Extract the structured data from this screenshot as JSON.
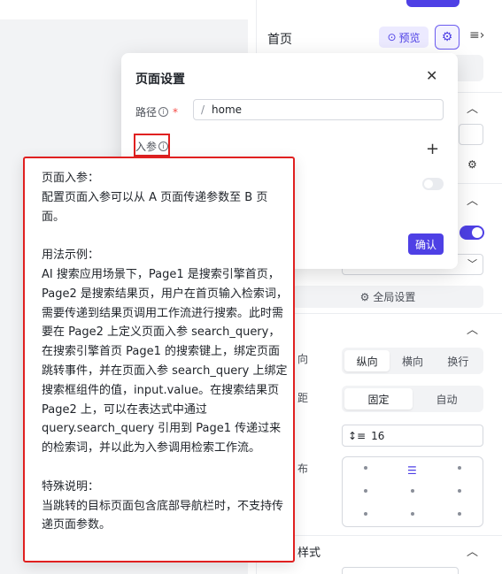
{
  "right_panel": {
    "title": "首页",
    "preview_label": "预览",
    "global_settings_label": "全局设置",
    "direction_options": [
      "纵向",
      "横向",
      "换行"
    ],
    "direction_selected": "纵向",
    "size_options": [
      "固定",
      "自动"
    ],
    "size_selected": "固定",
    "spacing_value": "16",
    "partial_labels": {
      "direction": "向",
      "spacing": "距",
      "align": "布",
      "style": "样式"
    }
  },
  "dialog": {
    "title": "页面设置",
    "path_label": "路径",
    "path_required": "*",
    "path_prefix": "/",
    "path_value": "home",
    "params_label": "入参",
    "confirm_label": "确认"
  },
  "tooltip": {
    "heading": "页面入参：",
    "intro": "配置页面入参可以从 A 页面传递参数至 B 页面。",
    "usage_heading": "用法示例：",
    "usage_body": "AI 搜索应用场景下，Page1 是搜索引擎首页，Page2 是搜索结果页，用户在首页输入检索词，需要传递到结果页调用工作流进行搜索。此时需要在 Page2 上定义页面入参 search_query，在搜索引擎首页 Page1 的搜索键上，绑定页面跳转事件，并在页面入参 search_query 上绑定搜索框组件的值，input.value。在搜索结果页 Page2 上，可以在表达式中通过 query.search_query 引用到 Page1 传递过来的检索词，并以此为入参调用检索工作流。",
    "note_heading": "特殊说明：",
    "note_body": "当跳转的目标页面包含底部导航栏时，不支持传递页面参数。"
  },
  "colors": {
    "accent": "#4e40e5",
    "highlight_border": "#e02020",
    "required": "#f54a45"
  },
  "icons": [
    "preview-icon",
    "gear-icon",
    "collapse-icon",
    "close-icon",
    "info-icon",
    "plus-icon",
    "chevron-up-icon",
    "chevron-down-icon",
    "line-height-icon"
  ]
}
